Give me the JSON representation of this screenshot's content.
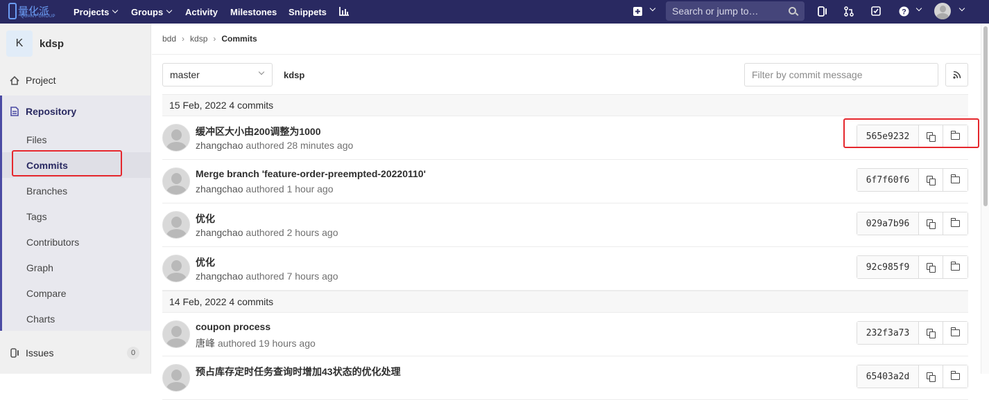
{
  "topbar": {
    "logo_text": "量化派",
    "logo_sub": "QUANT GROUP",
    "nav": [
      "Projects",
      "Groups",
      "Activity",
      "Milestones",
      "Snippets"
    ],
    "search_placeholder": "Search or jump to…",
    "icons": [
      "plus-icon",
      "issues-icon",
      "merge-request-icon",
      "todo-icon",
      "help-icon",
      "user-avatar"
    ]
  },
  "sidebar": {
    "project_initial": "K",
    "project_name": "kdsp",
    "project_label": "Project",
    "repository_label": "Repository",
    "repo_items": [
      "Files",
      "Commits",
      "Branches",
      "Tags",
      "Contributors",
      "Graph",
      "Compare",
      "Charts"
    ],
    "issues_label": "Issues",
    "issues_count": "0"
  },
  "breadcrumb": [
    "bdd",
    "kdsp",
    "Commits"
  ],
  "toolbar": {
    "branch": "master",
    "path": "kdsp",
    "filter_placeholder": "Filter by commit message"
  },
  "groups": [
    {
      "date": "15 Feb, 2022 4 commits",
      "commits": [
        {
          "title": "缓冲区大小由200调整为1000",
          "author": "zhangchao",
          "time": "authored 28 minutes ago",
          "sha": "565e9232"
        },
        {
          "title": "Merge branch 'feature-order-preempted-20220110'",
          "author": "zhangchao",
          "time": "authored 1 hour ago",
          "sha": "6f7f60f6"
        },
        {
          "title": "优化",
          "author": "zhangchao",
          "time": "authored 2 hours ago",
          "sha": "029a7b96"
        },
        {
          "title": "优化",
          "author": "zhangchao",
          "time": "authored 7 hours ago",
          "sha": "92c985f9"
        }
      ]
    },
    {
      "date": "14 Feb, 2022 4 commits",
      "commits": [
        {
          "title": "coupon process",
          "author": "唐峰",
          "time": "authored 19 hours ago",
          "sha": "232f3a73"
        },
        {
          "title": "预占库存定时任务查询时增加43状态的优化处理",
          "author": "",
          "time": "",
          "sha": "65403a2d"
        }
      ]
    }
  ],
  "colors": {
    "topbar": "#292961",
    "accent": "#4b4ba3",
    "highlight": "#e5272d"
  }
}
